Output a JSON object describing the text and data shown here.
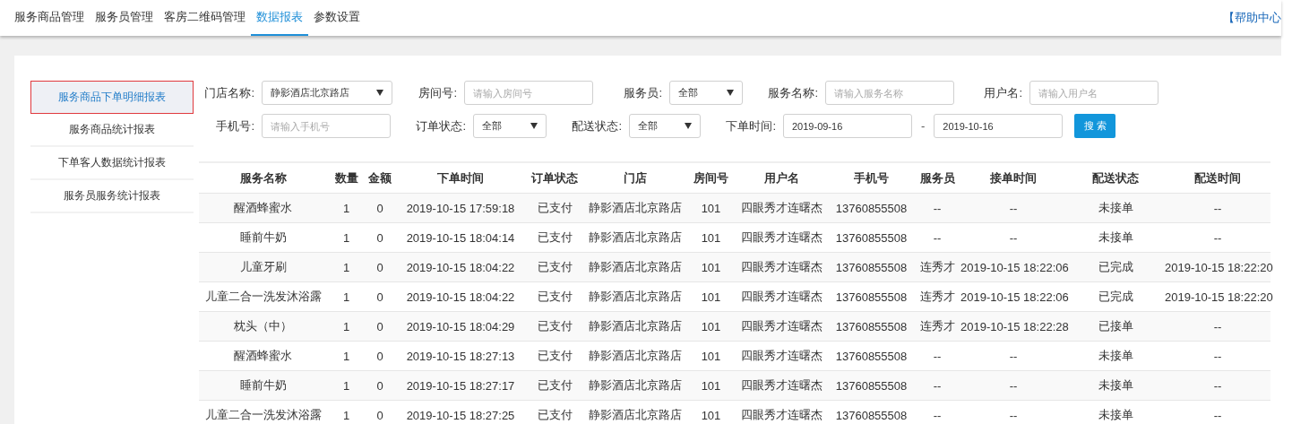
{
  "nav": {
    "tabs": [
      {
        "label": "服务商品管理",
        "selected": false
      },
      {
        "label": "服务员管理",
        "selected": false
      },
      {
        "label": "客房二维码管理",
        "selected": false
      },
      {
        "label": "数据报表",
        "selected": true
      },
      {
        "label": "参数设置",
        "selected": false
      }
    ],
    "help_link": "【帮助中心"
  },
  "sidebar": {
    "items": [
      {
        "label": "服务商品下单明细报表",
        "selected": true
      },
      {
        "label": "服务商品统计报表",
        "selected": false
      },
      {
        "label": "下单客人数据统计报表",
        "selected": false
      },
      {
        "label": "服务员服务统计报表",
        "selected": false
      }
    ]
  },
  "filters": {
    "rows": [
      [
        {
          "kind": "select",
          "label": "门店名称:",
          "value": "静影酒店北京路店"
        },
        {
          "kind": "input",
          "label": "房间号:",
          "placeholder": "请输入房间号"
        },
        {
          "kind": "select",
          "label": "服务员:",
          "value": "全部"
        },
        {
          "kind": "input",
          "label": "服务名称:",
          "placeholder": "请输入服务名称"
        },
        {
          "kind": "input",
          "label": "用户名:",
          "placeholder": "请输入用户名"
        }
      ],
      [
        {
          "kind": "input",
          "label": "手机号:",
          "placeholder": "请输入手机号"
        },
        {
          "kind": "select",
          "label": "订单状态:",
          "value": "全部"
        },
        {
          "kind": "select",
          "label": "配送状态:",
          "value": "全部"
        },
        {
          "kind": "daterange",
          "label": "下单时间:",
          "from": "2019-09-16",
          "separator": "-",
          "to": "2019-10-16"
        },
        {
          "kind": "button",
          "label": "搜 索"
        }
      ]
    ]
  },
  "table": {
    "columns": [
      "服务名称",
      "数量",
      "金额",
      "下单时间",
      "订单状态",
      "门店",
      "房间号",
      "用户名",
      "手机号",
      "服务员",
      "接单时间",
      "配送状态",
      "配送时间"
    ],
    "rows": [
      [
        "醒酒蜂蜜水",
        "1",
        "0",
        "2019-10-15 17:59:18",
        "已支付",
        "静影酒店北京路店",
        "101",
        "四眼秀才连曙杰",
        "13760855508",
        "--",
        "--",
        "未接单",
        "--"
      ],
      [
        "睡前牛奶",
        "1",
        "0",
        "2019-10-15 18:04:14",
        "已支付",
        "静影酒店北京路店",
        "101",
        "四眼秀才连曙杰",
        "13760855508",
        "--",
        "--",
        "未接单",
        "--"
      ],
      [
        "儿童牙刷",
        "1",
        "0",
        "2019-10-15 18:04:22",
        "已支付",
        "静影酒店北京路店",
        "101",
        "四眼秀才连曙杰",
        "13760855508",
        "连秀才",
        "2019-10-15 18:22:06",
        "已完成",
        "2019-10-15 18:22:20"
      ],
      [
        "儿童二合一洗发沐浴露",
        "1",
        "0",
        "2019-10-15 18:04:22",
        "已支付",
        "静影酒店北京路店",
        "101",
        "四眼秀才连曙杰",
        "13760855508",
        "连秀才",
        "2019-10-15 18:22:06",
        "已完成",
        "2019-10-15 18:22:20"
      ],
      [
        "枕头（中）",
        "1",
        "0",
        "2019-10-15 18:04:29",
        "已支付",
        "静影酒店北京路店",
        "101",
        "四眼秀才连曙杰",
        "13760855508",
        "连秀才",
        "2019-10-15 18:22:28",
        "已接单",
        "--"
      ],
      [
        "醒酒蜂蜜水",
        "1",
        "0",
        "2019-10-15 18:27:13",
        "已支付",
        "静影酒店北京路店",
        "101",
        "四眼秀才连曙杰",
        "13760855508",
        "--",
        "--",
        "未接单",
        "--"
      ],
      [
        "睡前牛奶",
        "1",
        "0",
        "2019-10-15 18:27:17",
        "已支付",
        "静影酒店北京路店",
        "101",
        "四眼秀才连曙杰",
        "13760855508",
        "--",
        "--",
        "未接单",
        "--"
      ],
      [
        "儿童二合一洗发沐浴露",
        "1",
        "0",
        "2019-10-15 18:27:25",
        "已支付",
        "静影酒店北京路店",
        "101",
        "四眼秀才连曙杰",
        "13760855508",
        "--",
        "--",
        "未接单",
        "--"
      ]
    ]
  }
}
